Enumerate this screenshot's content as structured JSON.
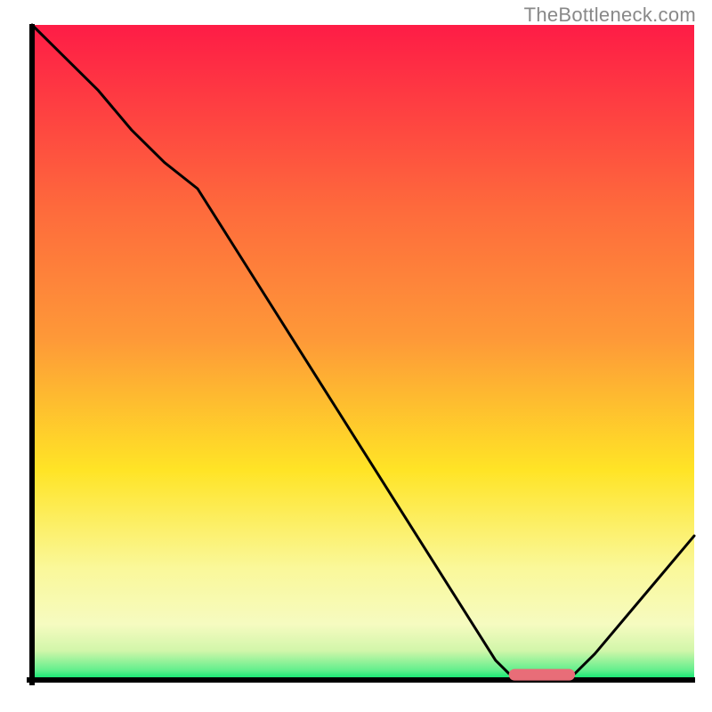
{
  "watermark": "TheBottleneck.com",
  "chart_data": {
    "type": "line",
    "title": "",
    "xlabel": "",
    "ylabel": "",
    "xlim": [
      0,
      100
    ],
    "ylim": [
      0,
      100
    ],
    "colors": {
      "curve": "#000000",
      "marker": "#e86d78",
      "axes": "#000000",
      "gradient_top": "#fe1c46",
      "gradient_mid_upper": "#fe9938",
      "gradient_mid": "#ffe426",
      "gradient_lower": "#faf89a",
      "gradient_band": "#d2f6aa",
      "gradient_bottom": "#00e66c"
    },
    "curve": {
      "x": [
        0,
        5,
        10,
        15,
        20,
        25,
        30,
        35,
        40,
        45,
        50,
        55,
        60,
        65,
        70,
        72,
        75,
        78,
        80,
        82,
        85,
        90,
        95,
        100
      ],
      "y": [
        100,
        95,
        90,
        84,
        79,
        75,
        67,
        59,
        51,
        43,
        35,
        27,
        19,
        11,
        3,
        1,
        0,
        0,
        0,
        1,
        4,
        10,
        16,
        22
      ]
    },
    "marker": {
      "x_start": 72,
      "x_end": 82,
      "y": 0.8
    },
    "axes_inset_percent": {
      "left": 4.5,
      "right": 2.5,
      "top": 3.5,
      "bottom": 4.5
    }
  }
}
